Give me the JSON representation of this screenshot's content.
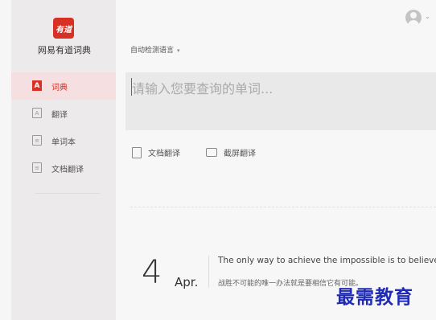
{
  "app": {
    "logo_text": "有道",
    "title": "网易有道词典"
  },
  "sidebar": {
    "items": [
      {
        "label": "词典",
        "icon": "A",
        "icon_name": "dictionary-icon",
        "active": true
      },
      {
        "label": "翻译",
        "icon": "A",
        "icon_name": "translate-icon",
        "active": false
      },
      {
        "label": "单词本",
        "icon": "≡",
        "icon_name": "wordbook-icon",
        "active": false
      },
      {
        "label": "文档翻译",
        "icon": "≡",
        "icon_name": "doc-translate-icon",
        "active": false
      }
    ]
  },
  "header": {
    "language_select": "自动检测语言"
  },
  "search": {
    "placeholder": "请输入您要查询的单词..."
  },
  "tools": {
    "doc_translate": "文档翻译",
    "screenshot_translate": "截屏翻译"
  },
  "daily": {
    "day": "4",
    "month": "Apr.",
    "quote_en": "The only way to achieve the impossible is to believe it is possible.",
    "quote_zh": "战胜不可能的唯一办法就是要相信它有可能。"
  },
  "watermark": "最需教育",
  "colors": {
    "accent": "#d93025",
    "sidebar_bg": "#eceaea",
    "active_bg": "#f5dfe0"
  }
}
